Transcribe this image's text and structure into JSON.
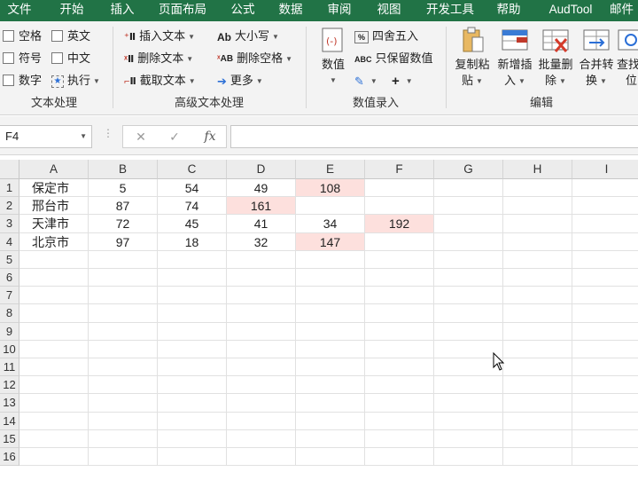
{
  "menubar": {
    "items": [
      "文件",
      "开始",
      "插入",
      "页面布局",
      "公式",
      "数据",
      "审阅",
      "视图",
      "开发工具",
      "帮助",
      "AudTool",
      "邮件"
    ]
  },
  "ribbon": {
    "group1": {
      "label": "文本处理",
      "checks": [
        "空格",
        "英文",
        "符号",
        "中文",
        "数字"
      ],
      "exec_label": "执行"
    },
    "group2": {
      "label": "高级文本处理",
      "insert_text": "插入文本",
      "delete_text": "删除文本",
      "extract_text": "截取文本",
      "case_label": "大小写",
      "delete_space": "删除空格",
      "more": "更多"
    },
    "group3": {
      "label": "数值录入",
      "value_btn": "数值",
      "round_label": "四舍五入",
      "keep_value": "只保留数值"
    },
    "group4": {
      "label": "编辑",
      "copy_paste": [
        "复制粘",
        "贴"
      ],
      "new_insert": [
        "新增插",
        "入"
      ],
      "batch_delete": [
        "批量删",
        "除"
      ],
      "merge_convert": [
        "合并转",
        "换"
      ],
      "find_locate": [
        "查找",
        "位"
      ]
    }
  },
  "formula_bar": {
    "name_box": "F4",
    "cancel_symbol": "✕",
    "confirm_symbol": "✓",
    "fx_symbol": "fx",
    "value": ""
  },
  "sheet": {
    "columns": [
      "A",
      "B",
      "C",
      "D",
      "E",
      "F",
      "G",
      "H",
      "I"
    ],
    "row_numbers": [
      "1",
      "2",
      "3",
      "4",
      "5",
      "6",
      "7",
      "8",
      "9",
      "10",
      "11",
      "12",
      "13",
      "14",
      "15",
      "16"
    ],
    "rows": [
      [
        "保定市",
        "5",
        "54",
        "49",
        "108",
        "",
        "",
        "",
        ""
      ],
      [
        "邢台市",
        "87",
        "74",
        "161",
        "",
        "",
        "",
        "",
        ""
      ],
      [
        "天津市",
        "72",
        "45",
        "41",
        "34",
        "192",
        "",
        "",
        ""
      ],
      [
        "北京市",
        "97",
        "18",
        "32",
        "147",
        "",
        "",
        "",
        ""
      ]
    ],
    "highlighted_cells": [
      "E1",
      "D2",
      "F3",
      "E4"
    ],
    "highlight_color": "#fde0dd"
  },
  "colors": {
    "accent": "#217346",
    "highlight": "#fde0dd"
  }
}
